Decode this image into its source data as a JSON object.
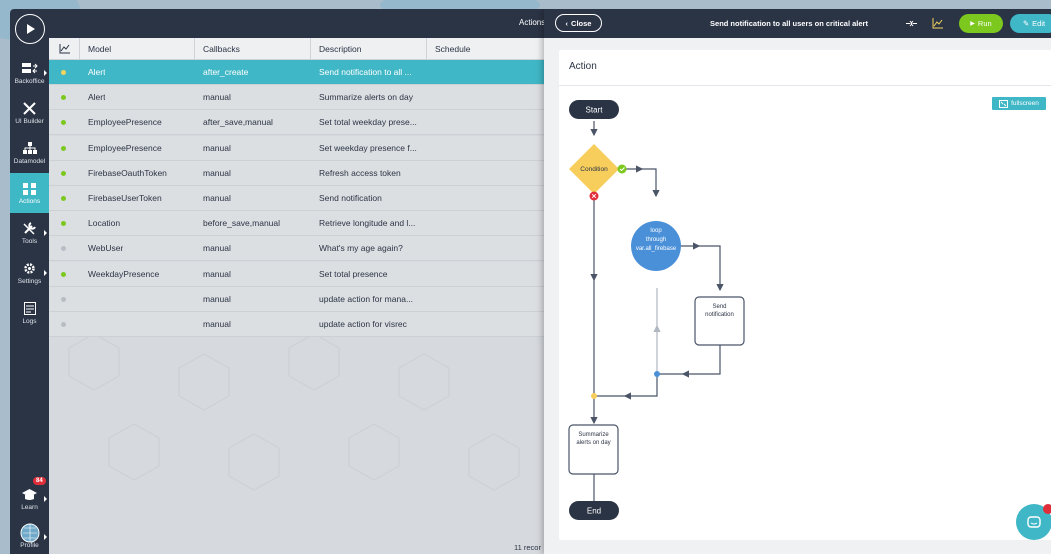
{
  "topbar": {
    "title": "Actions"
  },
  "sidebar": {
    "items": [
      {
        "label": "Backoffice",
        "icon": "backoffice-icon"
      },
      {
        "label": "UI Builder",
        "icon": "ui-builder-icon"
      },
      {
        "label": "Datamodel",
        "icon": "datamodel-icon"
      },
      {
        "label": "Actions",
        "icon": "actions-icon"
      },
      {
        "label": "Tools",
        "icon": "tools-icon"
      },
      {
        "label": "Settings",
        "icon": "settings-icon"
      },
      {
        "label": "Logs",
        "icon": "logs-icon"
      },
      {
        "label": "Learn",
        "icon": "learn-icon"
      },
      {
        "label": "Profile",
        "icon": "profile-icon"
      }
    ],
    "learn_badge": "84",
    "active": "Actions"
  },
  "table": {
    "headers": [
      "Model",
      "Callbacks",
      "Description",
      "Schedule"
    ],
    "rows": [
      {
        "model": "Alert",
        "callbacks": "after_create",
        "description": "Send notification to all ...",
        "status": "warning"
      },
      {
        "model": "Alert",
        "callbacks": "manual",
        "description": "Summarize alerts on day",
        "status": "active"
      },
      {
        "model": "EmployeePresence",
        "callbacks": "after_save,manual",
        "description": "Set total weekday prese...",
        "status": "active"
      },
      {
        "model": "EmployeePresence",
        "callbacks": "manual",
        "description": "Set weekday presence f...",
        "status": "active"
      },
      {
        "model": "FirebaseOauthToken",
        "callbacks": "manual",
        "description": "Refresh access token",
        "status": "active"
      },
      {
        "model": "FirebaseUserToken",
        "callbacks": "manual",
        "description": "Send notification",
        "status": "active"
      },
      {
        "model": "Location",
        "callbacks": "before_save,manual",
        "description": "Retrieve longitude and l...",
        "status": "active"
      },
      {
        "model": "WebUser",
        "callbacks": "manual",
        "description": "What's my age again?",
        "status": "inactive"
      },
      {
        "model": "WeekdayPresence",
        "callbacks": "manual",
        "description": "Set total presence",
        "status": "active"
      },
      {
        "model": "",
        "callbacks": "manual",
        "description": "update action for mana...",
        "status": "inactive"
      },
      {
        "model": "",
        "callbacks": "manual",
        "description": "update action for visrec",
        "status": "inactive"
      }
    ],
    "record_count": "11 recor"
  },
  "panel": {
    "close_label": "Close",
    "title": "Send notification to all users on critical alert",
    "run_label": "Run",
    "edit_label": "Edit",
    "section_label": "Action",
    "fullscreen_label": "fullscreen"
  },
  "flow": {
    "start": "Start",
    "condition": "Condition",
    "loop_line1": "loop",
    "loop_line2": "through",
    "loop_line3": "var.all_firebase",
    "send_line1": "Send",
    "send_line2": "notification",
    "summ_line1": "Summarize",
    "summ_line2": "alerts on day",
    "end": "End"
  },
  "colors": {
    "dark": "#2b3445",
    "accent": "#40b7c6",
    "run": "#7cc81e",
    "status_active": "#7cc81e",
    "status_warning": "#f5d45e",
    "status_inactive": "#b8bec6",
    "condition": "#f7cd5c",
    "loop": "#4a90d9"
  }
}
